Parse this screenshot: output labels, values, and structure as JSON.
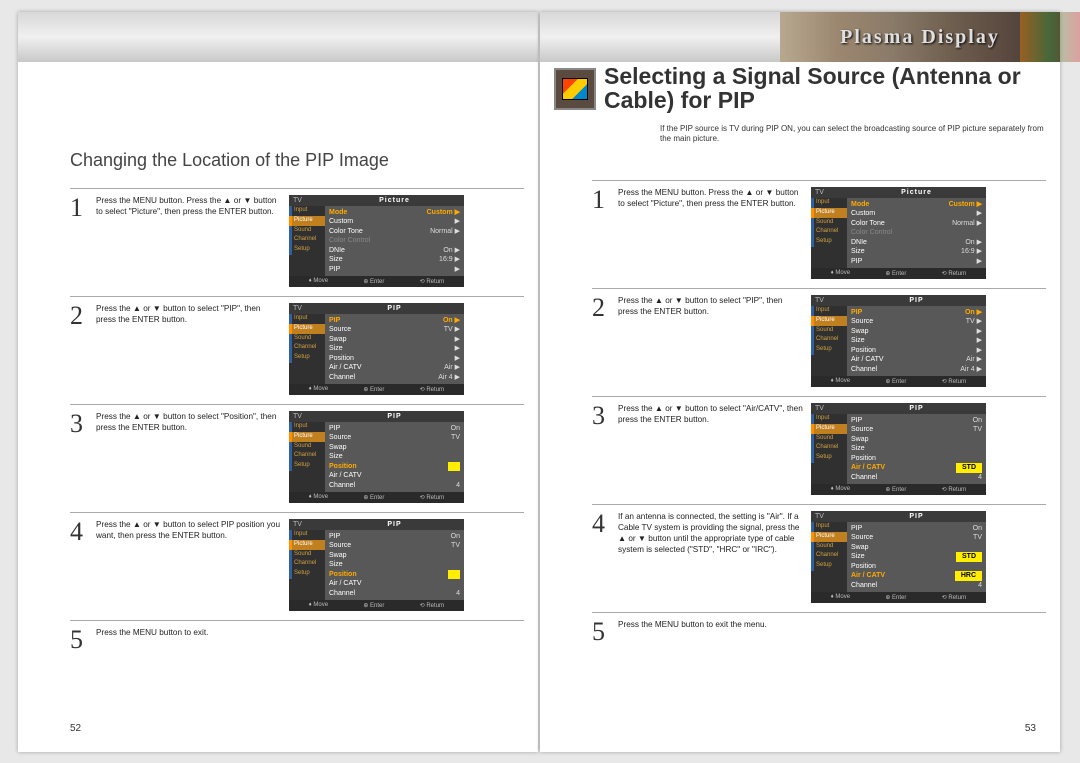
{
  "brand": "Plasma Display",
  "left": {
    "section_title": "Changing the Location of the PIP Image",
    "page_num": "52",
    "steps": [
      {
        "num": "1",
        "text": "Press the MENU button. Press the ▲ or ▼ button to select \"Picture\", then press the ENTER button.",
        "menu": "picture"
      },
      {
        "num": "2",
        "text": "Press the ▲ or ▼ button to select \"PIP\", then press the ENTER button.",
        "menu": "pip_top"
      },
      {
        "num": "3",
        "text": "Press the ▲ or ▼ button to select \"Position\", then press the ENTER button.",
        "menu": "pip_position_hl"
      },
      {
        "num": "4",
        "text": "Press the ▲ or ▼ button to select PIP position you want, then press the ENTER button.",
        "menu": "pip_position_sel"
      },
      {
        "num": "5",
        "text": "Press the MENU button to exit.",
        "menu": null
      }
    ]
  },
  "right": {
    "section_title": "Selecting a Signal Source (Antenna or Cable) for PIP",
    "intro": "If the PIP source is TV during PIP ON, you can select the broadcasting source of PIP picture separately from the main picture.",
    "page_num": "53",
    "steps": [
      {
        "num": "1",
        "text": "Press the MENU button. Press the ▲ or ▼ button to select \"Picture\", then press the ENTER button.",
        "menu": "picture"
      },
      {
        "num": "2",
        "text": "Press the ▲ or ▼ button to select \"PIP\", then press the ENTER button.",
        "menu": "pip_top"
      },
      {
        "num": "3",
        "text": "Press the ▲ or ▼ button to select \"Air/CATV\", then press the ENTER button.",
        "menu": "pip_aircatv_hl"
      },
      {
        "num": "4",
        "text": "If an antenna is connected, the setting is \"Air\". If a Cable TV system is providing the signal, press the ▲ or ▼ button until the appropriate type of cable system is selected (\"STD\", \"HRC\" or \"IRC\").",
        "menu": "pip_aircatv_sel"
      },
      {
        "num": "5",
        "text": "Press the MENU button to exit the menu.",
        "menu": null
      }
    ]
  },
  "osd": {
    "sidebar": [
      "Input",
      "Picture",
      "Sound",
      "Channel",
      "Setup"
    ],
    "footer": {
      "move": "Move",
      "enter": "Enter",
      "return": "Return"
    },
    "tv_label": "TV",
    "titles": {
      "picture": "Picture",
      "pip": "PIP"
    },
    "menus": {
      "picture": {
        "title": "Picture",
        "rows": [
          {
            "k": "Mode",
            "v": "Custom ▶",
            "hl": true
          },
          {
            "k": "Custom",
            "v": "▶"
          },
          {
            "k": "Color Tone",
            "v": "Normal ▶"
          },
          {
            "k": "Color Control",
            "v": "",
            "dim": true
          },
          {
            "k": "DNIe",
            "v": "On ▶"
          },
          {
            "k": "Size",
            "v": "16:9 ▶"
          },
          {
            "k": "PIP",
            "v": "▶"
          }
        ]
      },
      "pip_top": {
        "title": "PIP",
        "rows": [
          {
            "k": "PIP",
            "v": "On ▶",
            "hl": true
          },
          {
            "k": "Source",
            "v": "TV ▶"
          },
          {
            "k": "Swap",
            "v": "▶"
          },
          {
            "k": "Size",
            "v": "▶"
          },
          {
            "k": "Position",
            "v": "▶"
          },
          {
            "k": "Air / CATV",
            "v": "Air ▶"
          },
          {
            "k": "Channel",
            "v": "Air 4 ▶"
          }
        ]
      },
      "pip_position_hl": {
        "title": "PIP",
        "rows": [
          {
            "k": "PIP",
            "v": "On"
          },
          {
            "k": "Source",
            "v": "TV"
          },
          {
            "k": "Swap",
            "v": ""
          },
          {
            "k": "Size",
            "v": ""
          },
          {
            "k": "Position",
            "v": "",
            "hl": true,
            "yellow": true
          },
          {
            "k": "Air / CATV",
            "v": ""
          },
          {
            "k": "Channel",
            "v": "4"
          }
        ]
      },
      "pip_position_sel": {
        "title": "PIP",
        "rows": [
          {
            "k": "PIP",
            "v": "On"
          },
          {
            "k": "Source",
            "v": "TV"
          },
          {
            "k": "Swap",
            "v": ""
          },
          {
            "k": "Size",
            "v": ""
          },
          {
            "k": "Position",
            "v": "",
            "hl": true,
            "yellow": true
          },
          {
            "k": "Air / CATV",
            "v": ""
          },
          {
            "k": "Channel",
            "v": "4"
          }
        ]
      },
      "pip_aircatv_hl": {
        "title": "PIP",
        "rows": [
          {
            "k": "PIP",
            "v": "On"
          },
          {
            "k": "Source",
            "v": "TV"
          },
          {
            "k": "Swap",
            "v": ""
          },
          {
            "k": "Size",
            "v": ""
          },
          {
            "k": "Position",
            "v": ""
          },
          {
            "k": "Air / CATV",
            "v": "STD",
            "hl": true,
            "yellow": true
          },
          {
            "k": "Channel",
            "v": "4"
          }
        ]
      },
      "pip_aircatv_sel": {
        "title": "PIP",
        "rows": [
          {
            "k": "PIP",
            "v": "On"
          },
          {
            "k": "Source",
            "v": "TV"
          },
          {
            "k": "Swap",
            "v": ""
          },
          {
            "k": "Size",
            "v": "STD",
            "yellow": true
          },
          {
            "k": "Position",
            "v": ""
          },
          {
            "k": "Air / CATV",
            "v": "HRC",
            "hl": true,
            "yellow": true
          },
          {
            "k": "Channel",
            "v": "4"
          }
        ]
      }
    }
  }
}
